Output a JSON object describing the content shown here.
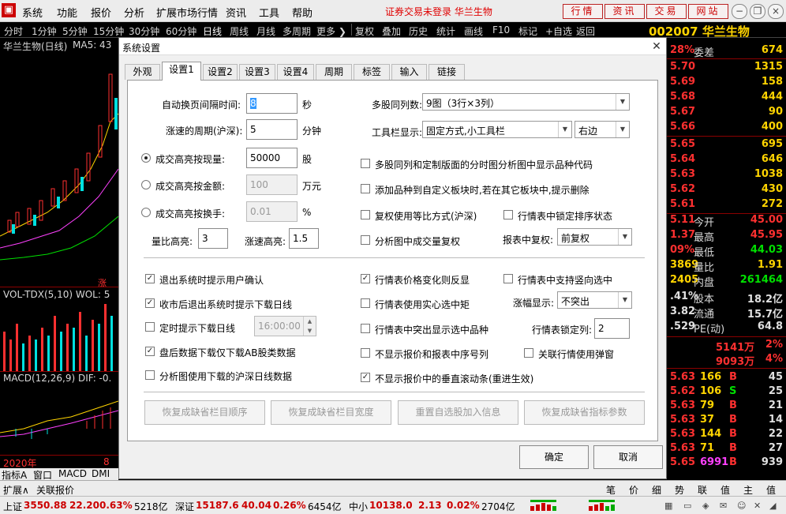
{
  "menu": {
    "items": [
      "系统",
      "功能",
      "报价",
      "分析",
      "扩展市场行情",
      "资讯",
      "工具",
      "帮助"
    ],
    "notice": "证券交易未登录",
    "stock_name": "华兰生物",
    "top_buttons": [
      "行情",
      "资讯",
      "交易",
      "网站"
    ]
  },
  "periods": [
    "分时",
    "1分钟",
    "5分钟",
    "15分钟",
    "30分钟",
    "60分钟",
    "日线",
    "周线",
    "月线",
    "多周期",
    "更多",
    "复权",
    "叠加",
    "历史",
    "统计",
    "画线",
    "F10",
    "标记",
    "+自选",
    "返回"
  ],
  "stock_title": "002007 华兰生物",
  "chart": {
    "title": "华兰生物(日线)",
    "ma": "MA5: 43",
    "vol": "VOL-TDX(5,10) WOL: 5",
    "macd": "MACD(12,26,9) DIF: -0.",
    "year": "2020年",
    "mark": "8",
    "zhang": "涨"
  },
  "right_panel": {
    "weicha": {
      "label": "委差",
      "pct": "28%",
      "value": "674"
    },
    "sells": [
      {
        "p": "5.70",
        "v": "1315"
      },
      {
        "p": "5.69",
        "v": "158"
      },
      {
        "p": "5.68",
        "v": "444"
      },
      {
        "p": "5.67",
        "v": "90"
      },
      {
        "p": "5.66",
        "v": "400"
      }
    ],
    "buys": [
      {
        "p": "5.65",
        "v": "695"
      },
      {
        "p": "5.64",
        "v": "646"
      },
      {
        "p": "5.63",
        "v": "1038"
      },
      {
        "p": "5.62",
        "v": "430"
      },
      {
        "p": "5.61",
        "v": "272"
      }
    ],
    "stats": [
      {
        "p": "5.11",
        "l": "今开",
        "v": "45.00"
      },
      {
        "p": "1.37",
        "l": "最高",
        "v": "45.95"
      },
      {
        "p": "09%",
        "l": "最低",
        "v": "44.03"
      },
      {
        "p": "3869",
        "l": "量比",
        "v": "1.91"
      },
      {
        "p": "2405",
        "l": "内盘",
        "v": "261464"
      }
    ],
    "stats2": [
      {
        "p": ".41%",
        "l": "股本",
        "v": "18.2亿"
      },
      {
        "p": "3.82",
        "l": "流通",
        "v": "15.7亿"
      },
      {
        "p": ".529",
        "l": "PE(动)",
        "v": "64.8"
      }
    ],
    "flow": [
      {
        "a": "5141万",
        "b": "2%"
      },
      {
        "a": "9093万",
        "b": "4%"
      }
    ],
    "ticks": [
      {
        "p": "5.63",
        "v": "166",
        "s": "B",
        "n": "45"
      },
      {
        "p": "5.62",
        "v": "106",
        "s": "S",
        "n": "25"
      },
      {
        "p": "5.63",
        "v": "79",
        "s": "B",
        "n": "21"
      },
      {
        "p": "5.63",
        "v": "37",
        "s": "B",
        "n": "14"
      },
      {
        "p": "5.63",
        "v": "144",
        "s": "B",
        "n": "22"
      },
      {
        "p": "5.63",
        "v": "71",
        "s": "B",
        "n": "27"
      },
      {
        "p": "5.65",
        "v": "6991",
        "s": "B",
        "n": "939"
      }
    ]
  },
  "bottom": {
    "tabs": [
      "指标A",
      "窗口",
      "MACD",
      "DMI"
    ],
    "expand": "扩展∧",
    "link": "关联报价",
    "right_tabs": [
      "笔",
      "价",
      "细",
      "势",
      "联",
      "值",
      "主",
      "值"
    ],
    "index": [
      {
        "name": "上证",
        "price": "3550.88",
        "chg": "22.20",
        "pct": "0.63%",
        "amt": "5218亿"
      },
      {
        "name": "深证",
        "price": "15187.6",
        "chg": "40.04",
        "pct": "0.26%",
        "amt": "6454亿"
      },
      {
        "name": "中小",
        "price": "10138.0",
        "chg": "2.13",
        "pct": "0.02%",
        "amt": "2704亿"
      }
    ]
  },
  "dialog": {
    "title": "系统设置",
    "tabs": [
      "外观",
      "设置1",
      "设置2",
      "设置3",
      "设置4",
      "周期",
      "标签",
      "输入",
      "链接"
    ],
    "fields": {
      "auto_page_label": "自动换页间隔时间:",
      "auto_page_value": "8",
      "auto_page_unit": "秒",
      "speed_label": "涨速的周期(沪深):",
      "speed_value": "5",
      "speed_unit": "分钟",
      "hl_now_label": "成交高亮按现量:",
      "hl_now_value": "50000",
      "hl_now_unit": "股",
      "hl_amt_label": "成交高亮按金额:",
      "hl_amt_value": "100",
      "hl_amt_unit": "万元",
      "hl_turn_label": "成交高亮按换手:",
      "hl_turn_value": "0.01",
      "hl_turn_unit": "%",
      "lb_label": "量比高亮:",
      "lb_value": "3",
      "zs_label": "涨速高亮:",
      "zs_value": "1.5",
      "multi_label": "多股同列数:",
      "multi_value": "9图（3行×3列）",
      "toolbar_label": "工具栏显示:",
      "toolbar_value": "固定方式,小工具栏",
      "toolbar_side": "右边",
      "fq_label": "报表中复权:",
      "fq_value": "前复权",
      "zf_label": "涨幅显示:",
      "zf_value": "不突出",
      "lock_label": "行情表锁定列:",
      "lock_value": "2",
      "time_value": "16:00:00"
    },
    "checks": {
      "c1": "多股同列和定制版面的分时图分析图中显示品种代码",
      "c2": "添加品种到自定义板块时,若在其它板块中,提示删除",
      "c3": "复权使用等比方式(沪深)",
      "c4": "行情表中锁定排序状态",
      "c5": "分析图中成交量复权",
      "e1": "退出系统时提示用户确认",
      "e2": "收市后退出系统时提示下载日线",
      "e3": "定时提示下载日线",
      "e4": "盘后数据下载仅下载AB股类数据",
      "e5": "分析图使用下载的沪深日线数据",
      "f1": "行情表价格变化则反显",
      "f2": "行情表中支持竖向选中",
      "f3": "行情表使用实心选中矩",
      "f4": "行情表中突出显示选中品种",
      "f5": "不显示报价和报表中序号列",
      "f6": "关联行情使用弹窗",
      "f7": "不显示报价中的垂直滚动条(重进生效)"
    },
    "panel_buttons": [
      "恢复成缺省栏目顺序",
      "恢复成缺省栏目宽度",
      "重置自选股加入信息",
      "恢复成缺省指标参数"
    ],
    "ok": "确定",
    "cancel": "取消"
  }
}
